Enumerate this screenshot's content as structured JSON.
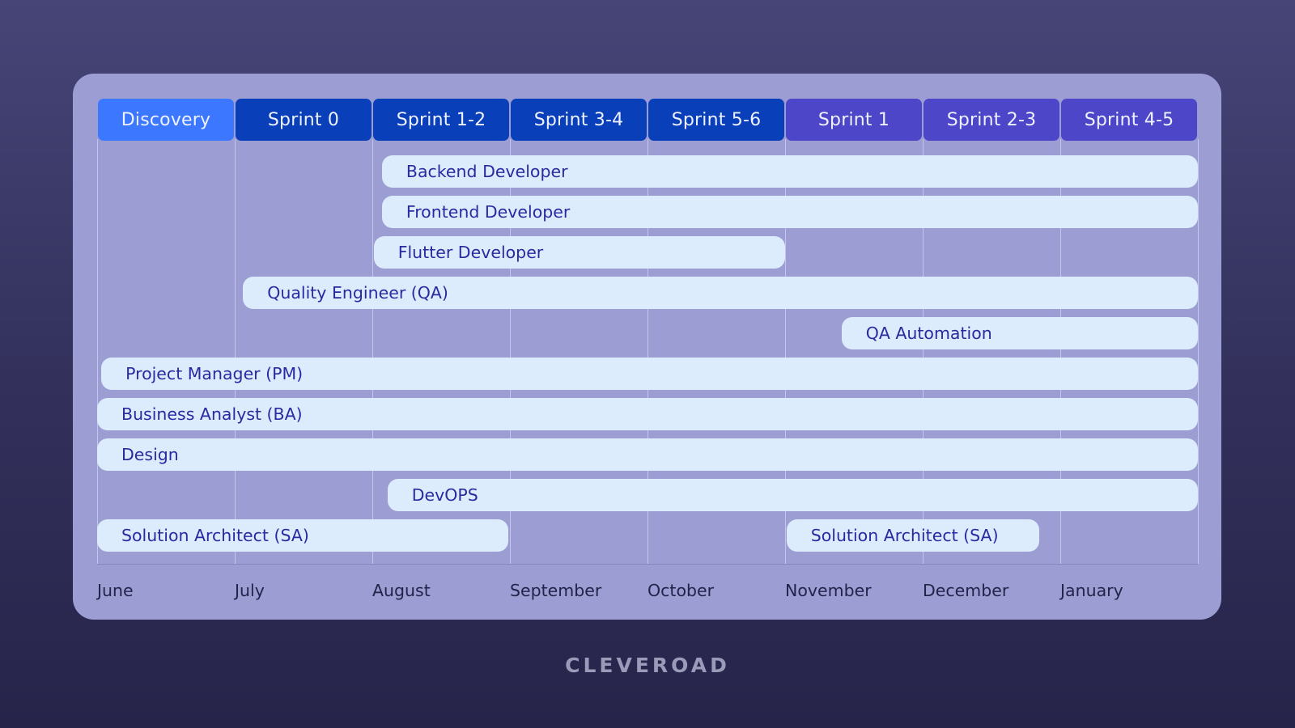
{
  "chart_data": {
    "type": "gantt",
    "title": "",
    "phases": [
      {
        "label": "Discovery",
        "color": "#3b78ff"
      },
      {
        "label": "Sprint 0",
        "color": "#0a3fba"
      },
      {
        "label": "Sprint 1-2",
        "color": "#0a3fba"
      },
      {
        "label": "Sprint 3-4",
        "color": "#0a3fba"
      },
      {
        "label": "Sprint 5-6",
        "color": "#0a3fba"
      },
      {
        "label": "Sprint 1",
        "color": "#4d46c9"
      },
      {
        "label": "Sprint 2-3",
        "color": "#4d46c9"
      },
      {
        "label": "Sprint 4-5",
        "color": "#4d46c9"
      }
    ],
    "months": [
      "June",
      "July",
      "August",
      "September",
      "October",
      "November",
      "December",
      "January"
    ],
    "tasks": [
      {
        "label": "Backend Developer",
        "start": 2.07,
        "end": 8.0
      },
      {
        "label": "Frontend Developer",
        "start": 2.07,
        "end": 8.0
      },
      {
        "label": "Flutter Developer",
        "start": 2.01,
        "end": 5.0
      },
      {
        "label": "Quality Engineer (QA)",
        "start": 1.06,
        "end": 8.0
      },
      {
        "label": "QA Automation",
        "start": 5.41,
        "end": 8.0
      },
      {
        "label": "Project Manager (PM)",
        "start": 0.03,
        "end": 8.0
      },
      {
        "label": "Business Analyst (BA)",
        "start": 0.0,
        "end": 8.0
      },
      {
        "label": "Design",
        "start": 0.0,
        "end": 8.0
      },
      {
        "label": "DevOPS",
        "start": 2.11,
        "end": 8.0
      },
      {
        "label": "Solution Architect (SA)",
        "start": 0.0,
        "end": 2.99
      },
      {
        "label": "Solution Architect (SA)",
        "start": 5.01,
        "end": 6.85
      }
    ],
    "xunit": "month columns (0 = start of June, 8 = end of January)"
  },
  "brand": {
    "logo_text": "CLEVEROAD"
  },
  "colors": {
    "bar_fill": "#dcecfd",
    "bar_text": "#2a2aa0",
    "card_bg": "#9c9ed3"
  }
}
